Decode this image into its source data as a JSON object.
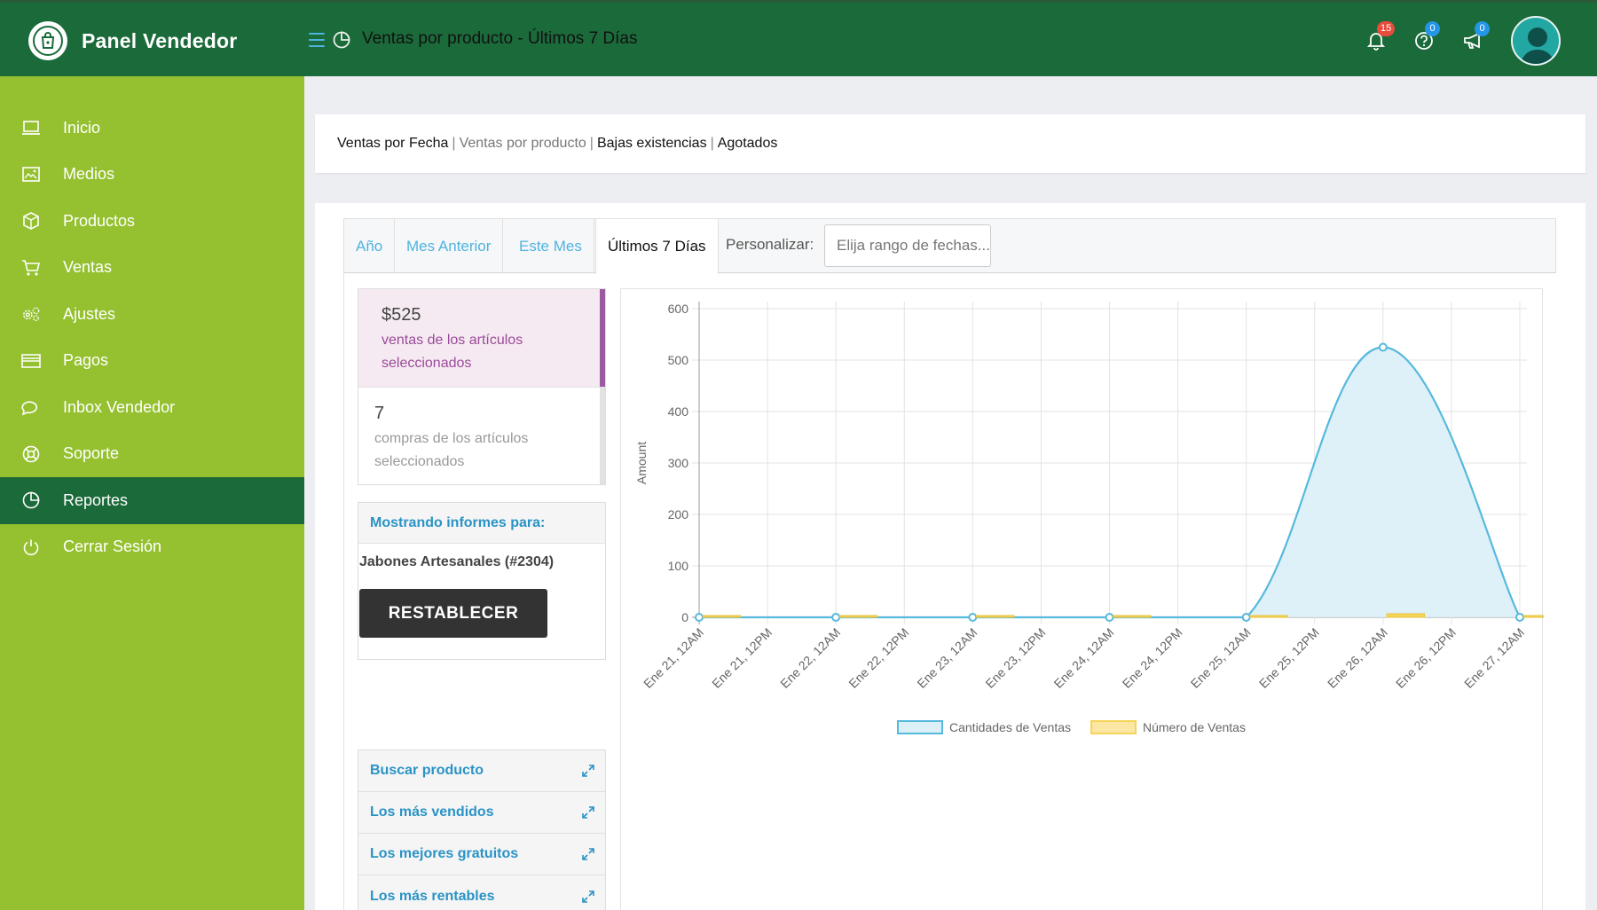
{
  "app": {
    "title": "Panel Vendedor"
  },
  "header": {
    "page_title": "Ventas por producto - Últimos 7 Días",
    "notifications": {
      "count": "15"
    },
    "help": {
      "count": "0"
    },
    "announcements": {
      "count": "0"
    }
  },
  "sidebar": {
    "items": [
      {
        "label": "Inicio",
        "icon": "laptop-icon"
      },
      {
        "label": "Medios",
        "icon": "image-icon"
      },
      {
        "label": "Productos",
        "icon": "box-icon"
      },
      {
        "label": "Ventas",
        "icon": "cart-icon"
      },
      {
        "label": "Ajustes",
        "icon": "gears-icon"
      },
      {
        "label": "Pagos",
        "icon": "credit-card-icon"
      },
      {
        "label": "Inbox Vendedor",
        "icon": "chat-icon"
      },
      {
        "label": "Soporte",
        "icon": "lifebuoy-icon"
      },
      {
        "label": "Reportes",
        "icon": "pie-chart-icon",
        "active": true
      },
      {
        "label": "Cerrar Sesión",
        "icon": "power-icon"
      }
    ]
  },
  "report_tabs": {
    "by_date": "Ventas por Fecha",
    "by_product": "Ventas por producto",
    "low_stock": "Bajas existencias",
    "out_of_stock": "Agotados",
    "separator": "|"
  },
  "range": {
    "year": "Año",
    "last_month": "Mes Anterior",
    "this_month": "Este Mes",
    "last_7_days": "Últimos 7 Días",
    "custom_label": "Personalizar:",
    "date_placeholder": "Elija rango de fechas..."
  },
  "stats": {
    "sales_value": "$525",
    "sales_label": "ventas de los artículos seleccionados",
    "purchases_value": "7",
    "purchases_label": "compras de los artículos seleccionados"
  },
  "filter": {
    "heading": "Mostrando informes para:",
    "product": "Jabones Artesanales (#2304)",
    "reset_label": "RESTABLECER"
  },
  "widgets": [
    {
      "label": "Buscar producto"
    },
    {
      "label": "Los más vendidos"
    },
    {
      "label": "Los mejores gratuitos"
    },
    {
      "label": "Los más rentables"
    }
  ],
  "colors": {
    "topbar": "#1b6a3a",
    "sidebar": "#95c130",
    "accent_blue": "#4fb3e0",
    "series_amount_line": "#56b9dd",
    "series_amount_fill": "#dcf0f7",
    "series_count": "#f5d45a"
  },
  "chart_data": {
    "type": "line",
    "ylabel": "Amount",
    "ylim": [
      0,
      600
    ],
    "y_ticks": [
      0,
      100,
      200,
      300,
      400,
      500,
      600
    ],
    "x_labels": [
      "Ene 21, 12AM",
      "Ene 21, 12PM",
      "Ene 22, 12AM",
      "Ene 22, 12PM",
      "Ene 23, 12AM",
      "Ene 23, 12PM",
      "Ene 24, 12AM",
      "Ene 24, 12PM",
      "Ene 25, 12AM",
      "Ene 25, 12PM",
      "Ene 26, 12AM",
      "Ene 26, 12PM",
      "Ene 27, 12AM"
    ],
    "grid": true,
    "legend_position": "bottom",
    "series": [
      {
        "name": "Cantidades de Ventas",
        "style": "area",
        "x": [
          "Ene 21, 12AM",
          "Ene 22, 12AM",
          "Ene 23, 12AM",
          "Ene 24, 12AM",
          "Ene 25, 12AM",
          "Ene 26, 12AM",
          "Ene 27, 12AM"
        ],
        "values": [
          0,
          0,
          0,
          0,
          0,
          525,
          0
        ]
      },
      {
        "name": "Número de Ventas",
        "style": "bar",
        "x": [
          "Ene 21, 12AM",
          "Ene 22, 12AM",
          "Ene 23, 12AM",
          "Ene 24, 12AM",
          "Ene 25, 12AM",
          "Ene 26, 12AM",
          "Ene 27, 12AM"
        ],
        "values": [
          0,
          0,
          0,
          0,
          0,
          7,
          0
        ]
      }
    ]
  }
}
